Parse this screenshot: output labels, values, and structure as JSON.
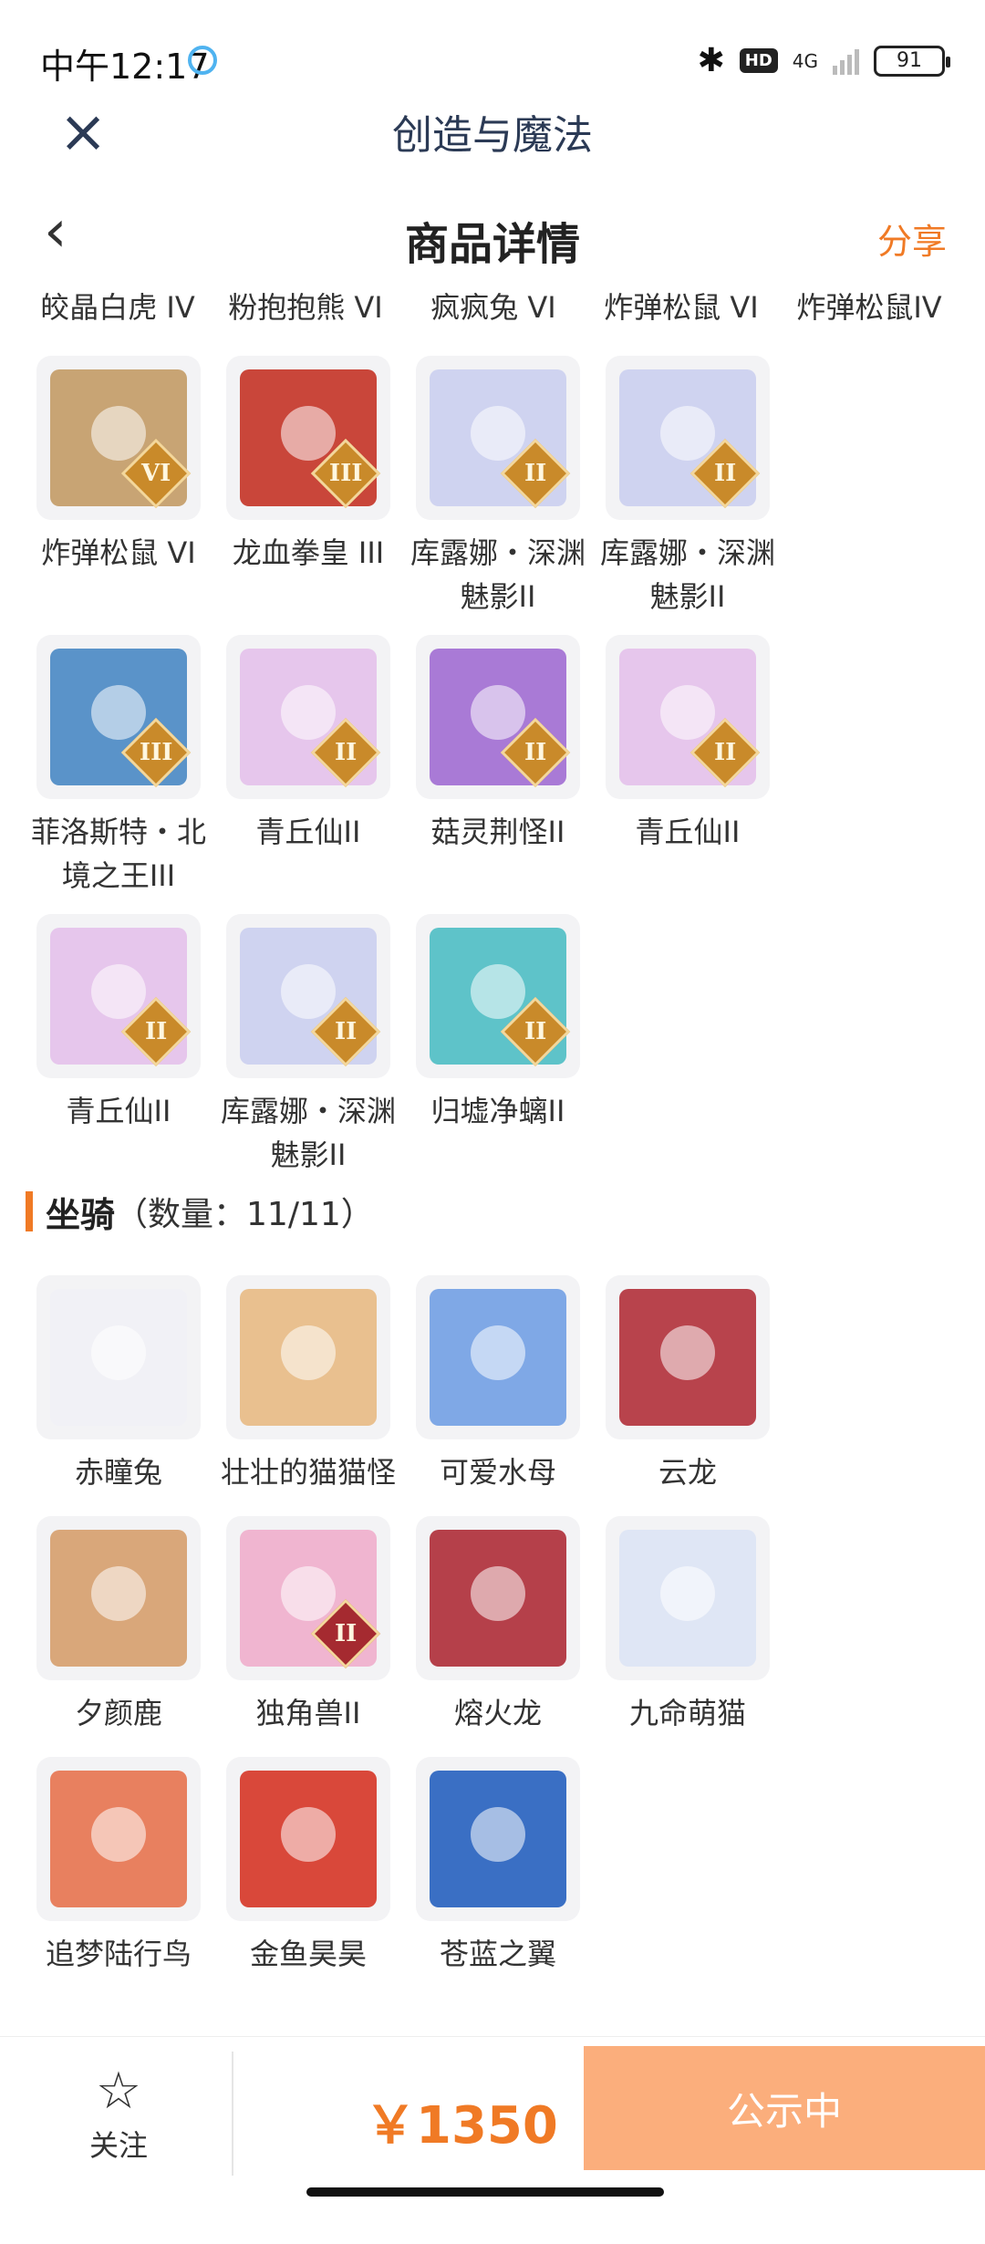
{
  "status_bar": {
    "time": "中午12:17",
    "network": "4G",
    "battery": "91"
  },
  "header": {
    "title": "创造与魔法"
  },
  "nav": {
    "title": "商品详情",
    "share": "分享"
  },
  "top_names": [
    "皎晶白虎 IV",
    "粉抱抱熊 VI",
    "疯疯兔 VI",
    "炸弹松鼠 VI",
    "炸弹松鼠IV"
  ],
  "pets": [
    {
      "name": "炸弹松鼠 VI",
      "rank": "VI",
      "color": "#c8a474"
    },
    {
      "name": "龙血拳皇 III",
      "rank": "III",
      "color": "#c9463a"
    },
    {
      "name": "库露娜・深渊魅影II",
      "rank": "II",
      "color": "#cfd3f0"
    },
    {
      "name": "库露娜・深渊魅影II",
      "rank": "II",
      "color": "#cfd3f0"
    },
    {
      "name": "菲洛斯特・北境之王III",
      "rank": "III",
      "color": "#5a93c9"
    },
    {
      "name": "青丘仙II",
      "rank": "II",
      "color": "#e6c6ec"
    },
    {
      "name": "菇灵荆怪II",
      "rank": "II",
      "color": "#a97ad6"
    },
    {
      "name": "青丘仙II",
      "rank": "II",
      "color": "#e6c6ec"
    },
    {
      "name": "青丘仙II",
      "rank": "II",
      "color": "#e6c6ec"
    },
    {
      "name": "库露娜・深渊魅影II",
      "rank": "II",
      "color": "#cfd3f0"
    },
    {
      "name": "归墟净螭II",
      "rank": "II",
      "color": "#5ec3c9"
    }
  ],
  "mounts_section": {
    "title": "坐骑",
    "count": "（数量：11/11）"
  },
  "mounts": [
    {
      "name": "赤瞳兔",
      "rank": "",
      "color": "#f1f1f6"
    },
    {
      "name": "壮壮的猫猫怪",
      "rank": "",
      "color": "#e9c08f"
    },
    {
      "name": "可爱水母",
      "rank": "",
      "color": "#7fa8e6"
    },
    {
      "name": "云龙",
      "rank": "",
      "color": "#b8434c"
    },
    {
      "name": "夕颜鹿",
      "rank": "",
      "color": "#d9a77a"
    },
    {
      "name": "独角兽II",
      "rank": "II",
      "color": "#f0b5d0"
    },
    {
      "name": "熔火龙",
      "rank": "",
      "color": "#b5404a"
    },
    {
      "name": "九命萌猫",
      "rank": "",
      "color": "#dfe6f5"
    },
    {
      "name": "追梦陆行鸟",
      "rank": "",
      "color": "#e8805f"
    },
    {
      "name": "金鱼昊昊",
      "rank": "",
      "color": "#d9483a"
    },
    {
      "name": "苍蓝之翼",
      "rank": "",
      "color": "#3a6fc4"
    }
  ],
  "footer": {
    "follow": "关注",
    "price": "￥1350",
    "status": "公示中"
  }
}
